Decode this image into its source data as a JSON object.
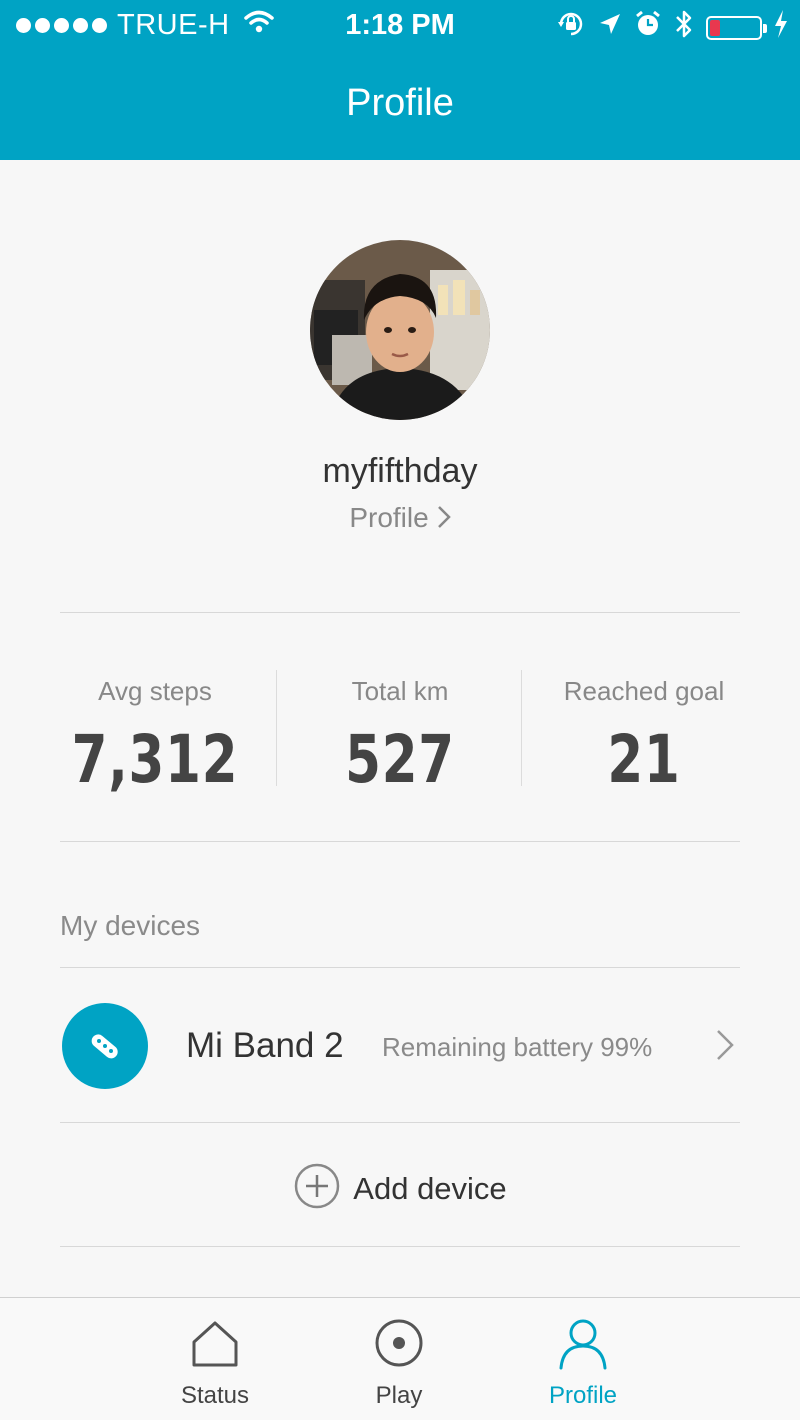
{
  "status_bar": {
    "carrier": "TRUE-H",
    "time": "1:18 PM",
    "battery_level": 0.15
  },
  "header": {
    "title": "Profile"
  },
  "profile": {
    "username": "myfifthday",
    "link_label": "Profile"
  },
  "stats": [
    {
      "label": "Avg steps",
      "value": "7,312"
    },
    {
      "label": "Total km",
      "value": "527"
    },
    {
      "label": "Reached goal",
      "value": "21"
    }
  ],
  "devices": {
    "section_title": "My devices",
    "items": [
      {
        "name": "Mi Band 2",
        "battery_text": "Remaining battery 99%"
      }
    ],
    "add_label": "Add device"
  },
  "tabbar": {
    "tabs": [
      {
        "label": "Status",
        "icon": "home-icon"
      },
      {
        "label": "Play",
        "icon": "target-icon"
      },
      {
        "label": "Profile",
        "icon": "person-icon",
        "active": true
      }
    ]
  },
  "colors": {
    "accent": "#00a3c4",
    "battery_low": "#e8384f"
  }
}
